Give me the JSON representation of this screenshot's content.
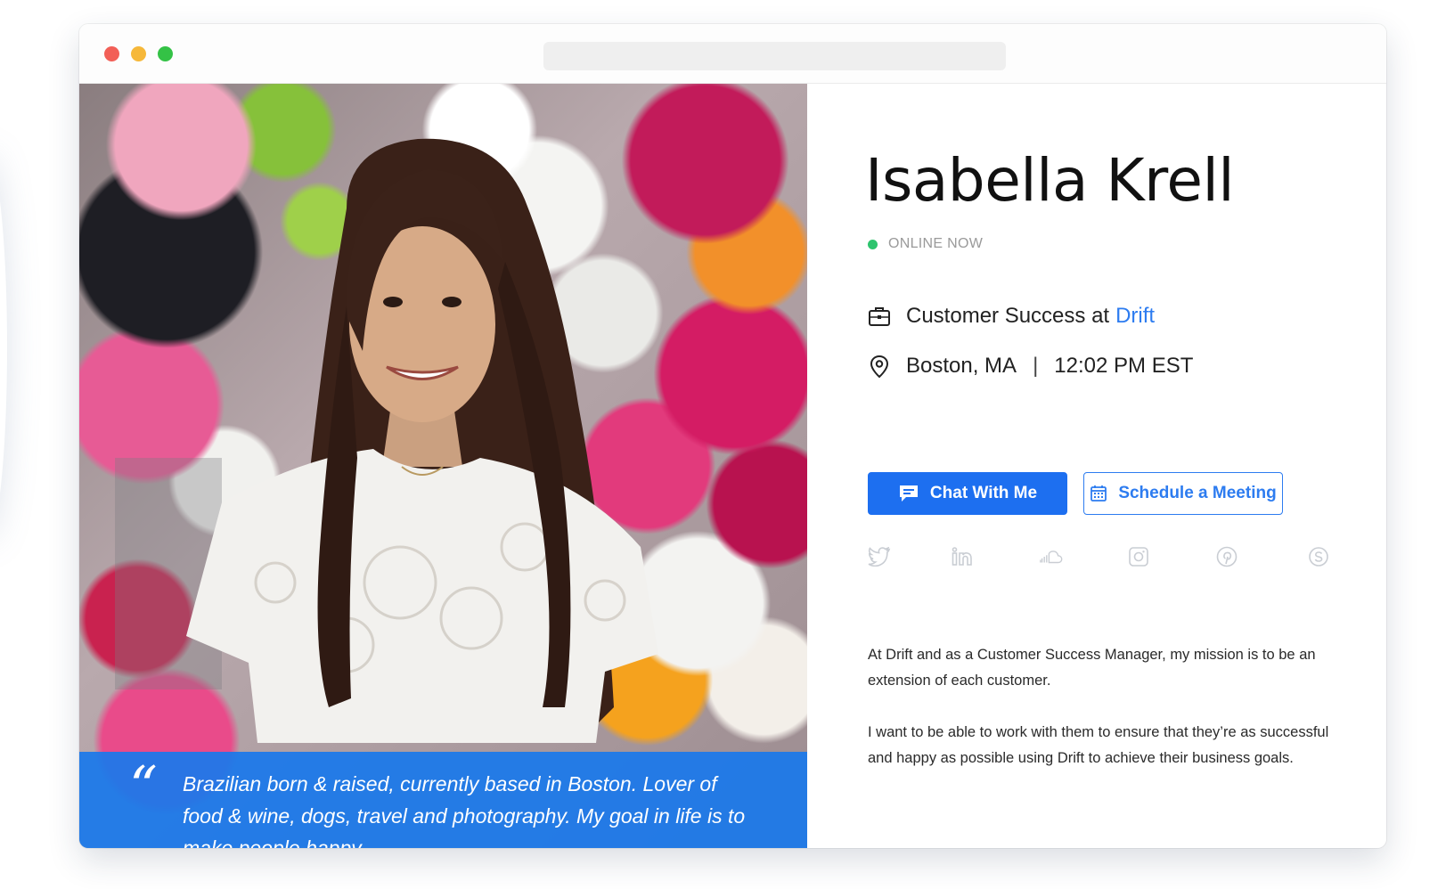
{
  "window": {
    "controls": [
      "close",
      "minimize",
      "maximize"
    ],
    "url_value": ""
  },
  "profile": {
    "name": "Isabella Krell",
    "status": "ONLINE NOW",
    "role_prefix": "Customer Success at",
    "company": "Drift",
    "location": "Boston, MA",
    "separator": "|",
    "local_time": "12:02 PM EST",
    "quote_mark": "“",
    "quote": "Brazilian born & raised, currently based in Boston. Lover of food & wine, dogs, travel and photography. My goal in life is to make people happy.",
    "bio": [
      "At Drift and as a Customer Success Manager, my mission is to be an extension of each customer.",
      "I want to be able to work with them to ensure that they’re as successful and happy as possible using Drift to achieve their business goals."
    ]
  },
  "buttons": {
    "chat_label": "Chat With Me",
    "chat_icon": "chat-bubble-icon",
    "meeting_label": "Schedule a Meeting",
    "meeting_icon": "calendar-icon"
  },
  "socials": [
    "twitter",
    "linkedin",
    "soundcloud",
    "instagram",
    "pinterest",
    "skype"
  ],
  "colors": {
    "accent": "#1d6ff0",
    "link": "#2d7cf0",
    "online": "#2ec46e",
    "quote_bar": "#1a78eb",
    "muted_icons": "#c9cdd3"
  }
}
